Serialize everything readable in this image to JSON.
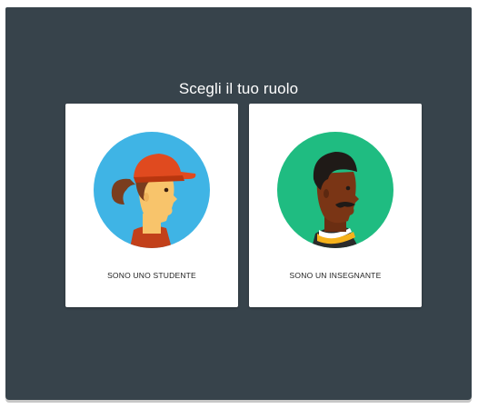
{
  "page": {
    "title": "Scegli il tuo ruolo"
  },
  "roles": [
    {
      "label": "SONO UNO STUDENTE",
      "icon": "student-avatar-icon",
      "color": "#3fb4e5"
    },
    {
      "label": "SONO UN INSEGNANTE",
      "icon": "teacher-avatar-icon",
      "color": "#1fbc81"
    }
  ],
  "colors": {
    "background": "#37434b",
    "card": "#ffffff",
    "student_circle": "#3fb4e5",
    "teacher_circle": "#1fbc81",
    "cap": "#e04a1f"
  }
}
